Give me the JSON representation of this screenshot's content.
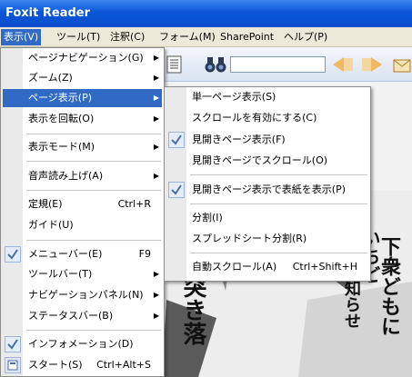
{
  "title": "Foxit Reader",
  "menubar": [
    {
      "label": "表示(V)",
      "active": true
    },
    {
      "label": "ツール(T)"
    },
    {
      "label": "注釈(C)"
    },
    {
      "label": "フォーム(M)"
    },
    {
      "label": "SharePoint"
    },
    {
      "label": "ヘルプ(P)"
    }
  ],
  "view_menu": {
    "items": [
      {
        "label": "ページナビゲーション(G)",
        "submenu": true
      },
      {
        "label": "ズーム(Z)",
        "submenu": true
      },
      {
        "label": "ページ表示(P)",
        "submenu": true,
        "selected": true
      },
      {
        "label": "表示を回転(O)",
        "submenu": true
      },
      {
        "label": "表示モード(M)",
        "submenu": true
      },
      {
        "label": "音声読み上げ(A)",
        "submenu": true
      },
      {
        "label": "定規(E)",
        "accel": "Ctrl+R"
      },
      {
        "label": "ガイド(U)"
      },
      {
        "label": "メニューバー(E)",
        "accel": "F9",
        "checked": true
      },
      {
        "label": "ツールバー(T)",
        "submenu": true
      },
      {
        "label": "ナビゲーションパネル(N)",
        "submenu": true
      },
      {
        "label": "ステータスバー(B)",
        "submenu": true
      },
      {
        "label": "インフォメーション(D)",
        "checked": true
      },
      {
        "label": "スタート(S)",
        "accel": "Ctrl+Alt+S",
        "icon": true
      }
    ]
  },
  "page_display_menu": {
    "items": [
      {
        "label": "単一ページ表示(S)"
      },
      {
        "label": "スクロールを有効にする(C)"
      },
      {
        "label": "見開きページ表示(F)",
        "checked": true
      },
      {
        "label": "見開きページでスクロール(O)"
      },
      {
        "label": "見開きページ表示で表紙を表示(P)",
        "checked": true
      },
      {
        "label": "分割(I)"
      },
      {
        "label": "スプレッドシート分割(R)"
      },
      {
        "label": "自動スクロール(A)",
        "accel": "Ctrl+Shift+H"
      }
    ]
  },
  "manga_text": {
    "col1": "下衆どもに",
    "col2": "いちど",
    "col3": "い知らせ",
    "big": "突き落"
  }
}
